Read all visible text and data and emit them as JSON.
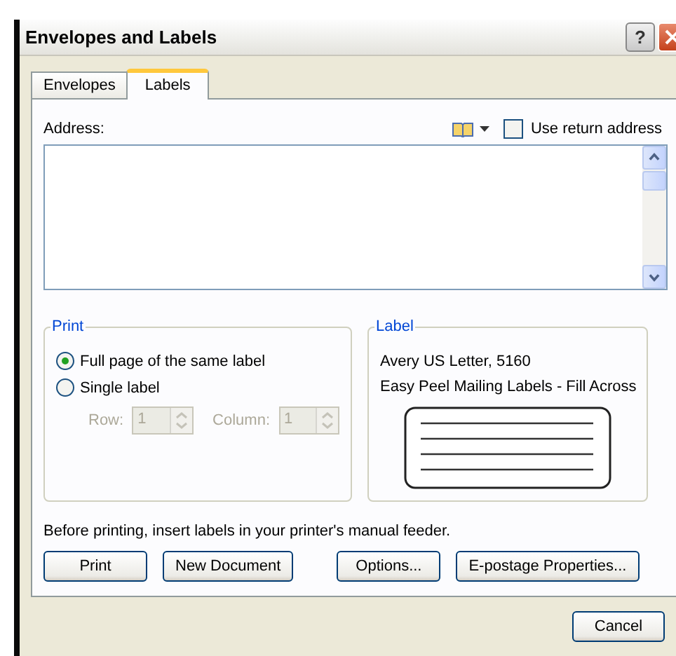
{
  "window": {
    "title": "Envelopes and Labels"
  },
  "title_buttons": [
    {
      "kind": "help",
      "label": "?"
    },
    {
      "kind": "close"
    }
  ],
  "tabs": [
    {
      "label": "Envelopes",
      "selected": false
    },
    {
      "label": "Labels",
      "selected": true
    }
  ],
  "address": {
    "label": "Address:"
  },
  "use_return_address": {
    "label": "Use return address",
    "checked": false
  },
  "print_group": {
    "title": "Print",
    "options": [
      {
        "label": "Full page of the same label",
        "selected": true
      },
      {
        "label": "Single label",
        "selected": false
      }
    ],
    "spinners": [
      {
        "label": "Row:",
        "value": "1",
        "disabled": true
      },
      {
        "label": "Column:",
        "value": "1",
        "disabled": true
      }
    ]
  },
  "label_group": {
    "title": "Label",
    "lines": [
      "Avery US Letter, 5160",
      "Easy Peel Mailing Labels - Fill Across"
    ]
  },
  "note": "Before printing, insert labels in your printer's manual feeder.",
  "buttons": [
    "Print",
    "New Document",
    "Options...",
    "E-postage Properties..."
  ],
  "footer_buttons": [
    "Cancel"
  ]
}
